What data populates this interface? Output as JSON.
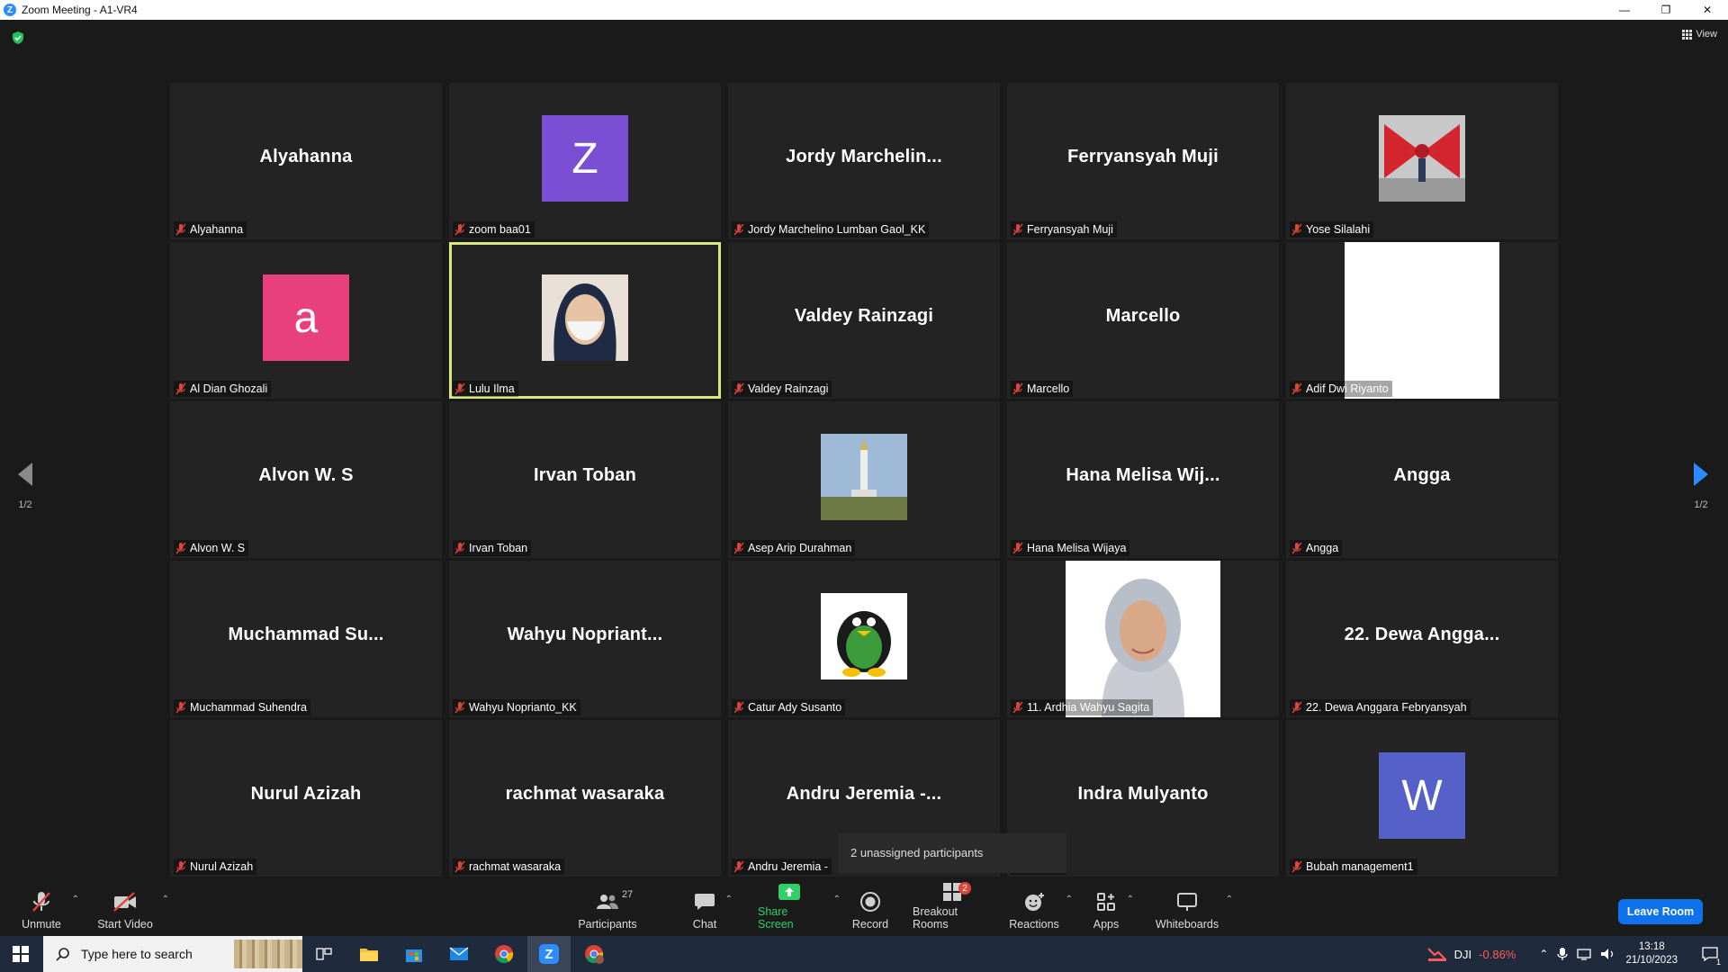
{
  "window": {
    "title": "Zoom Meeting - A1-VR4",
    "minimize": "—",
    "restore": "❐",
    "close": "✕"
  },
  "view_label": "View",
  "page_indicator_left": "1/2",
  "page_indicator_right": "1/2",
  "tiles": [
    {
      "big": "Alyahanna",
      "label": "Alyahanna",
      "type": "name"
    },
    {
      "big": "",
      "label": "zoom baa01",
      "type": "avatar",
      "letter": "Z",
      "color": "#7b4fd4"
    },
    {
      "big": "Jordy  Marchelin...",
      "label": "Jordy Marchelino Lumban Gaol_KK",
      "type": "name"
    },
    {
      "big": "Ferryansyah Muji",
      "label": "Ferryansyah Muji",
      "type": "name"
    },
    {
      "big": "",
      "label": "Yose Silalahi",
      "type": "photo-red"
    },
    {
      "big": "",
      "label": "Al Dian Ghozali",
      "type": "avatar",
      "letter": "a",
      "color": "#e8407a"
    },
    {
      "big": "",
      "label": "Lulu Ilma",
      "type": "photo-hijab",
      "active": true
    },
    {
      "big": "Valdey Rainzagi",
      "label": "Valdey Rainzagi",
      "type": "name"
    },
    {
      "big": "Marcello",
      "label": "Marcello",
      "type": "name"
    },
    {
      "big": "",
      "label": "Adif Dwi Riyanto",
      "type": "white"
    },
    {
      "big": "Alvon W. S",
      "label": "Alvon W. S",
      "type": "name"
    },
    {
      "big": "Irvan Toban",
      "label": "Irvan Toban",
      "type": "name"
    },
    {
      "big": "",
      "label": "Asep Arip Durahman",
      "type": "photo-monument"
    },
    {
      "big": "Hana  Melisa  Wij...",
      "label": "Hana Melisa Wijaya",
      "type": "name"
    },
    {
      "big": "Angga",
      "label": "Angga",
      "type": "name"
    },
    {
      "big": "Muchammad  Su...",
      "label": "Muchammad Suhendra",
      "type": "name"
    },
    {
      "big": "Wahyu  Nopriant...",
      "label": "Wahyu Noprianto_KK",
      "type": "name"
    },
    {
      "big": "",
      "label": "Catur Ady Susanto",
      "type": "photo-penguin"
    },
    {
      "big": "",
      "label": "11. Ardhia Wahyu Sagita",
      "type": "photo-portrait"
    },
    {
      "big": "22.  Dewa  Angga...",
      "label": "22. Dewa Anggara Febryansyah",
      "type": "name"
    },
    {
      "big": "Nurul Azizah",
      "label": "Nurul Azizah",
      "type": "name"
    },
    {
      "big": "rachmat wasaraka",
      "label": "rachmat wasaraka",
      "type": "name"
    },
    {
      "big": "Andru  Jeremia  -...",
      "label": "Andru Jeremia - ",
      "type": "name"
    },
    {
      "big": "Indra Mulyanto",
      "label": "ulyanto",
      "type": "name"
    },
    {
      "big": "",
      "label": "Bubah management1",
      "type": "avatar",
      "letter": "W",
      "color": "#5560c8"
    }
  ],
  "tooltip": "2 unassigned participants",
  "toolbar": {
    "unmute": "Unmute",
    "start_video": "Start Video",
    "participants": "Participants",
    "participants_count": "27",
    "chat": "Chat",
    "share_screen": "Share Screen",
    "record": "Record",
    "breakout_rooms": "Breakout Rooms",
    "breakout_badge": "2",
    "reactions": "Reactions",
    "apps": "Apps",
    "whiteboards": "Whiteboards",
    "leave": "Leave Room"
  },
  "taskbar": {
    "search_placeholder": "Type here to search",
    "stock_name": "DJI",
    "stock_change": "-0.86%",
    "time": "13:18",
    "date": "21/10/2023",
    "notification_count": "1"
  },
  "colors": {
    "active_speaker": "#d6e97a",
    "leave_button": "#0e72ed",
    "share_green": "#2fd068",
    "stock_red": "#ff5a5a",
    "nav_arrow": "#2d8cff"
  }
}
